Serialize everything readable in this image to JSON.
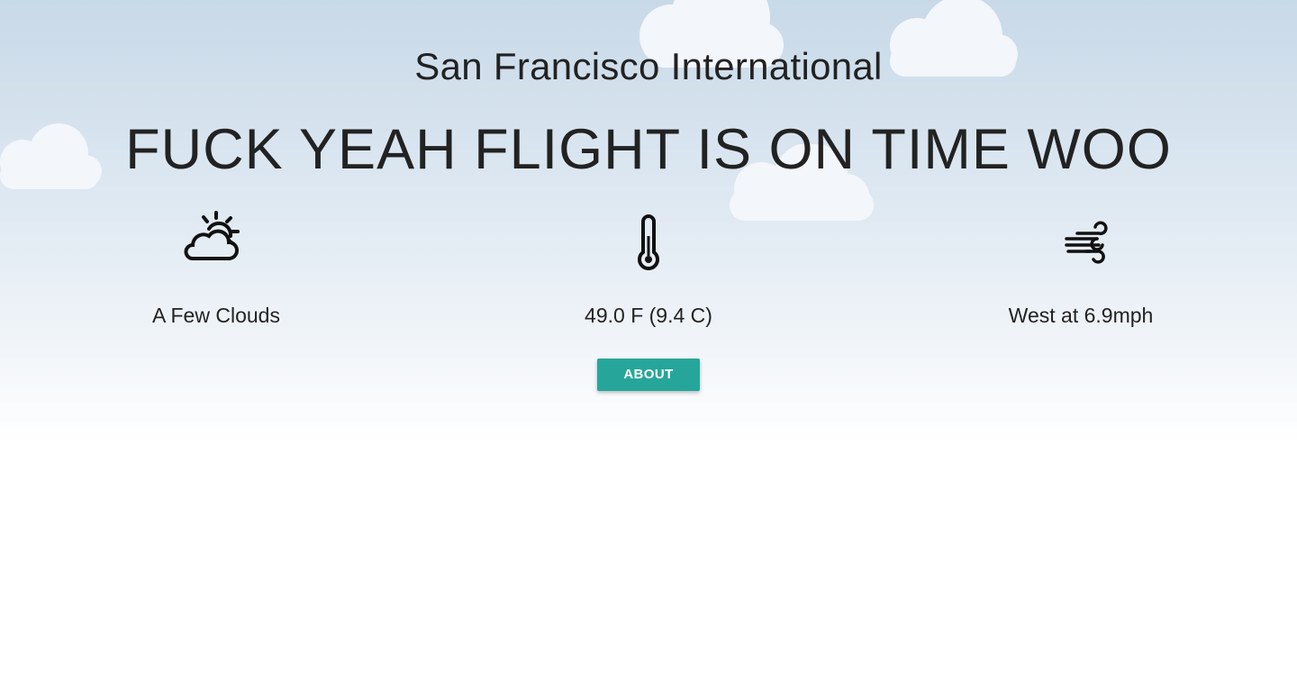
{
  "airport": {
    "name": "San Francisco International"
  },
  "flight": {
    "status_message": "FUCK YEAH FLIGHT IS ON TIME WOO"
  },
  "weather": {
    "condition": "A Few Clouds",
    "condition_icon": "partly-cloudy-icon",
    "temperature": "49.0 F (9.4 C)",
    "temperature_icon": "thermometer-icon",
    "wind": "West at 6.9mph",
    "wind_icon": "wind-icon"
  },
  "actions": {
    "about_label": "ABOUT"
  },
  "colors": {
    "accent": "#26a69a",
    "sky_top": "#c8d9e8",
    "text": "#222222"
  }
}
